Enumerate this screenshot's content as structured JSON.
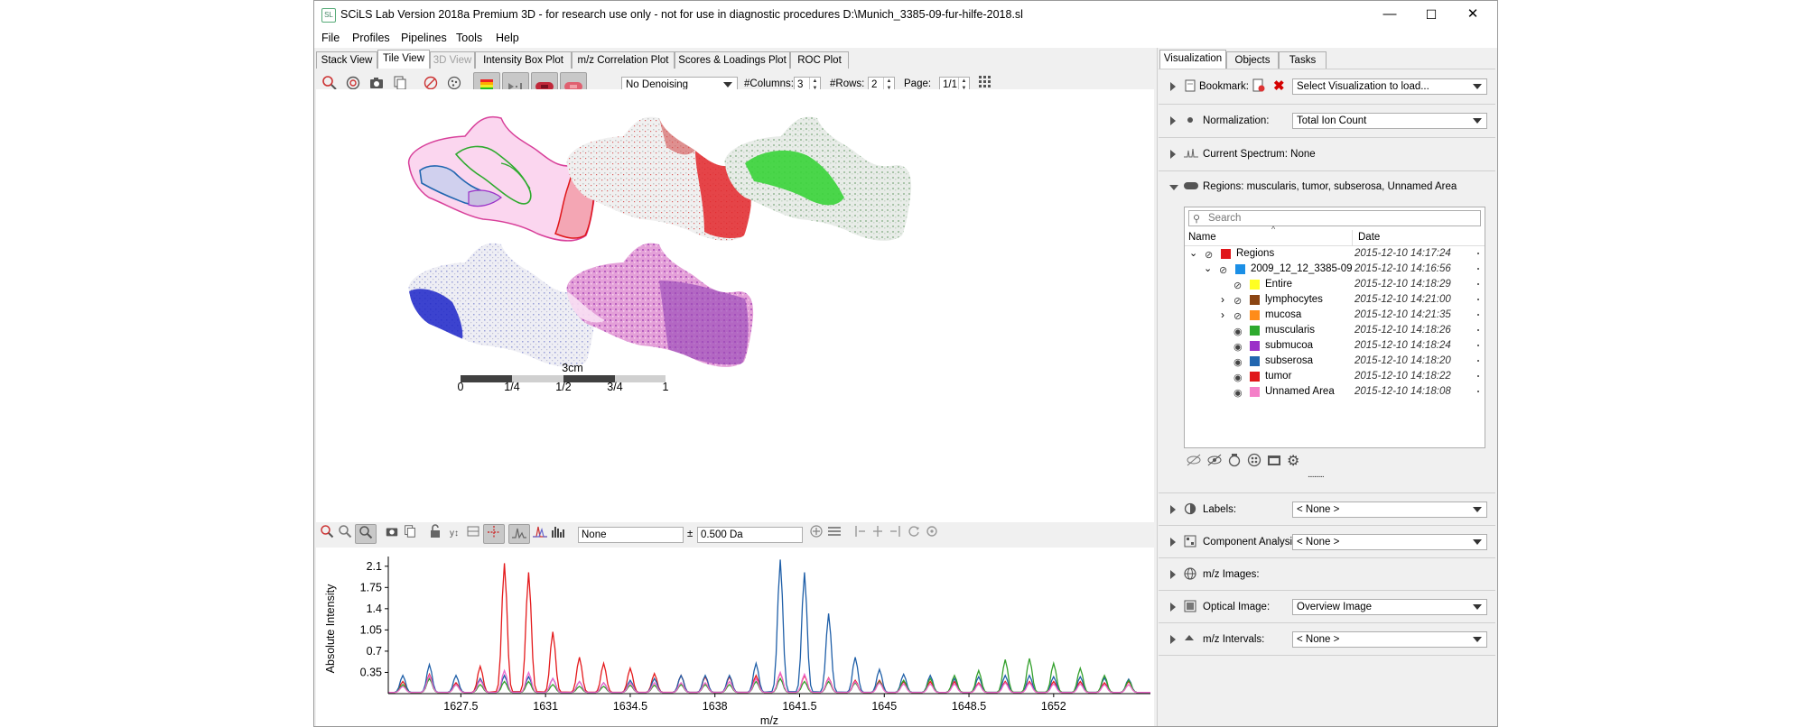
{
  "window": {
    "title": "SCiLS Lab Version 2018a Premium 3D - for research use only - not for use in diagnostic procedures D:\\Munich_3385-09-fur-hilfe-2018.sl",
    "logo_text": "SL",
    "minimize": "—",
    "maximize": "☐",
    "close": "✕"
  },
  "menu": [
    "File",
    "Profiles",
    "Pipelines",
    "Tools",
    "Help"
  ],
  "view_tabs": [
    {
      "label": "Stack View"
    },
    {
      "label": "Tile View",
      "active": true
    },
    {
      "label": "3D View",
      "disabled": true
    },
    {
      "label": "Intensity Box Plot"
    },
    {
      "label": "m/z Correlation Plot"
    },
    {
      "label": "Scores & Loadings Plot"
    },
    {
      "label": "ROC Plot"
    }
  ],
  "image_toolbar": {
    "denoising": "No Denoising",
    "columns_label": "#Columns:",
    "columns_value": "3",
    "rows_label": "#Rows:",
    "rows_value": "2",
    "page_label": "Page:",
    "page_value": "1/1"
  },
  "scalebar": {
    "title": "3cm",
    "ticks": [
      "0",
      "1/4",
      "1/2",
      "3/4",
      "1"
    ]
  },
  "spectrum_toolbar": {
    "mz_value": "None",
    "pm": "±",
    "tolerance": "0.500 Da"
  },
  "spectrum_chart": {
    "chart_data": {
      "type": "line",
      "xlabel": "m/z",
      "ylabel": "Absolute Intensity",
      "xlim": [
        1624.5,
        1656
      ],
      "ylim": [
        0,
        2.26
      ],
      "x_ticks": [
        "1627.5",
        "1631",
        "1634.5",
        "1638",
        "1641.5",
        "1645",
        "1648.5",
        "1652"
      ],
      "y_ticks": [
        "0.35",
        "0.7",
        "1.05",
        "1.4",
        "1.75",
        "2.1"
      ],
      "series": [
        {
          "color": "#e41a1c",
          "peaks": [
            [
              1625.1,
              0.2
            ],
            [
              1626.2,
              0.32
            ],
            [
              1627.3,
              0.18
            ],
            [
              1628.3,
              0.45
            ],
            [
              1629.3,
              2.15
            ],
            [
              1630.3,
              2.0
            ],
            [
              1631.3,
              1.02
            ],
            [
              1632.4,
              0.6
            ],
            [
              1633.4,
              0.5
            ],
            [
              1634.5,
              0.42
            ],
            [
              1635.5,
              0.33
            ],
            [
              1636.6,
              0.3
            ],
            [
              1637.6,
              0.28
            ],
            [
              1638.6,
              0.28
            ],
            [
              1639.7,
              0.3
            ],
            [
              1640.7,
              0.34
            ],
            [
              1641.7,
              0.3
            ],
            [
              1642.7,
              0.26
            ],
            [
              1643.8,
              0.22
            ],
            [
              1644.8,
              0.22
            ],
            [
              1645.8,
              0.2
            ],
            [
              1646.9,
              0.2
            ],
            [
              1647.9,
              0.2
            ],
            [
              1648.9,
              0.18
            ],
            [
              1650.0,
              0.2
            ],
            [
              1651.0,
              0.2
            ],
            [
              1652.0,
              0.2
            ],
            [
              1653.1,
              0.2
            ],
            [
              1654.1,
              0.18
            ],
            [
              1655.1,
              0.2
            ]
          ]
        },
        {
          "color": "#1f5fa8",
          "peaks": [
            [
              1625.1,
              0.3
            ],
            [
              1626.2,
              0.48
            ],
            [
              1627.3,
              0.3
            ],
            [
              1628.3,
              0.25
            ],
            [
              1629.3,
              0.3
            ],
            [
              1630.3,
              0.28
            ],
            [
              1631.3,
              0.25
            ],
            [
              1632.4,
              0.2
            ],
            [
              1633.4,
              0.18
            ],
            [
              1634.5,
              0.22
            ],
            [
              1635.5,
              0.25
            ],
            [
              1636.6,
              0.3
            ],
            [
              1637.6,
              0.3
            ],
            [
              1638.6,
              0.3
            ],
            [
              1639.7,
              0.5
            ],
            [
              1640.7,
              2.21
            ],
            [
              1641.7,
              2.0
            ],
            [
              1642.7,
              1.32
            ],
            [
              1643.8,
              0.6
            ],
            [
              1644.8,
              0.4
            ],
            [
              1645.8,
              0.32
            ],
            [
              1646.9,
              0.3
            ],
            [
              1647.9,
              0.25
            ],
            [
              1648.9,
              0.28
            ],
            [
              1650.0,
              0.3
            ],
            [
              1651.0,
              0.3
            ],
            [
              1652.0,
              0.28
            ],
            [
              1653.1,
              0.28
            ],
            [
              1654.1,
              0.26
            ],
            [
              1655.1,
              0.24
            ]
          ]
        },
        {
          "color": "#33a02c",
          "peaks": [
            [
              1625.1,
              0.15
            ],
            [
              1626.2,
              0.25
            ],
            [
              1627.3,
              0.15
            ],
            [
              1628.3,
              0.15
            ],
            [
              1629.3,
              0.2
            ],
            [
              1630.3,
              0.2
            ],
            [
              1631.3,
              0.15
            ],
            [
              1632.4,
              0.12
            ],
            [
              1633.4,
              0.12
            ],
            [
              1634.5,
              0.14
            ],
            [
              1635.5,
              0.14
            ],
            [
              1636.6,
              0.15
            ],
            [
              1637.6,
              0.15
            ],
            [
              1638.6,
              0.15
            ],
            [
              1639.7,
              0.2
            ],
            [
              1640.7,
              0.25
            ],
            [
              1641.7,
              0.2
            ],
            [
              1642.7,
              0.2
            ],
            [
              1643.8,
              0.18
            ],
            [
              1644.8,
              0.2
            ],
            [
              1645.8,
              0.22
            ],
            [
              1646.9,
              0.25
            ],
            [
              1647.9,
              0.3
            ],
            [
              1648.9,
              0.38
            ],
            [
              1650.0,
              0.56
            ],
            [
              1651.0,
              0.58
            ],
            [
              1652.0,
              0.5
            ],
            [
              1653.1,
              0.42
            ],
            [
              1654.1,
              0.3
            ],
            [
              1655.1,
              0.22
            ]
          ]
        },
        {
          "color": "#ee66cc",
          "peaks": [
            [
              1625.1,
              0.12
            ],
            [
              1626.2,
              0.3
            ],
            [
              1627.3,
              0.15
            ],
            [
              1628.3,
              0.22
            ],
            [
              1629.3,
              0.38
            ],
            [
              1630.3,
              0.35
            ],
            [
              1631.3,
              0.25
            ],
            [
              1632.4,
              0.2
            ],
            [
              1633.4,
              0.18
            ],
            [
              1634.5,
              0.18
            ],
            [
              1635.5,
              0.18
            ],
            [
              1636.6,
              0.18
            ],
            [
              1637.6,
              0.18
            ],
            [
              1638.6,
              0.2
            ],
            [
              1639.7,
              0.25
            ],
            [
              1640.7,
              0.35
            ],
            [
              1641.7,
              0.32
            ],
            [
              1642.7,
              0.25
            ],
            [
              1643.8,
              0.2
            ],
            [
              1644.8,
              0.18
            ],
            [
              1645.8,
              0.16
            ],
            [
              1646.9,
              0.16
            ],
            [
              1647.9,
              0.16
            ],
            [
              1648.9,
              0.16
            ],
            [
              1650.0,
              0.18
            ],
            [
              1651.0,
              0.18
            ],
            [
              1652.0,
              0.16
            ],
            [
              1653.1,
              0.16
            ],
            [
              1654.1,
              0.15
            ],
            [
              1655.1,
              0.15
            ]
          ]
        }
      ]
    }
  },
  "right_tabs": [
    "Visualization",
    "Objects",
    "Tasks"
  ],
  "sections": {
    "bookmark": {
      "label": "Bookmark:",
      "value": "Select Visualization to load..."
    },
    "normalization": {
      "label": "Normalization:",
      "value": "Total Ion Count"
    },
    "current_spectrum": {
      "label": "Current Spectrum: None"
    },
    "regions": {
      "label": "Regions: muscularis, tumor, subserosa, Unnamed Area"
    },
    "labels": {
      "label": "Labels:",
      "value": "< None >"
    },
    "component": {
      "label": "Component Analysis:",
      "value": "< None >"
    },
    "mz_images": {
      "label": "m/z Images:"
    },
    "optical": {
      "label": "Optical Image:",
      "value": "Overview Image"
    },
    "mz_intervals": {
      "label": "m/z Intervals:",
      "value": "< None >"
    }
  },
  "tree": {
    "search_placeholder": "Search",
    "col_name": "Name",
    "col_date": "Date",
    "rows": [
      {
        "name": "Regions",
        "date": "2015-12-10 14:17:24",
        "color": "#e0161a",
        "level": 0,
        "exp": "open",
        "eye": "closed"
      },
      {
        "name": "2009_12_12_3385-09",
        "date": "2015-12-10 14:16:56",
        "color": "#1b8fe6",
        "level": 1,
        "exp": "open",
        "eye": "closed"
      },
      {
        "name": "Entire",
        "date": "2015-12-10 14:18:29",
        "color": "#ffff22",
        "level": 2,
        "exp": "",
        "eye": "closed"
      },
      {
        "name": "lymphocytes",
        "date": "2015-12-10 14:21:00",
        "color": "#8b4513",
        "level": 2,
        "exp": "closed",
        "eye": "closed"
      },
      {
        "name": "mucosa",
        "date": "2015-12-10 14:21:35",
        "color": "#ff8c1a",
        "level": 2,
        "exp": "closed",
        "eye": "closed"
      },
      {
        "name": "muscularis",
        "date": "2015-12-10 14:18:26",
        "color": "#2eaa2e",
        "level": 2,
        "exp": "",
        "eye": "open"
      },
      {
        "name": "submucoa",
        "date": "2015-12-10 14:18:24",
        "color": "#9b30c8",
        "level": 2,
        "exp": "",
        "eye": "open"
      },
      {
        "name": "subserosa",
        "date": "2015-12-10 14:18:20",
        "color": "#2166b0",
        "level": 2,
        "exp": "",
        "eye": "open"
      },
      {
        "name": "tumor",
        "date": "2015-12-10 14:18:22",
        "color": "#e0161a",
        "level": 2,
        "exp": "",
        "eye": "open"
      },
      {
        "name": "Unnamed Area",
        "date": "2015-12-10 14:18:08",
        "color": "#f47fc8",
        "level": 2,
        "exp": "",
        "eye": "open"
      }
    ]
  },
  "dotted_handle": "..........",
  "icons": {
    "eye_open": "◉",
    "eye_closed": "⊘",
    "exp_open": "⌄",
    "exp_closed": "›"
  }
}
